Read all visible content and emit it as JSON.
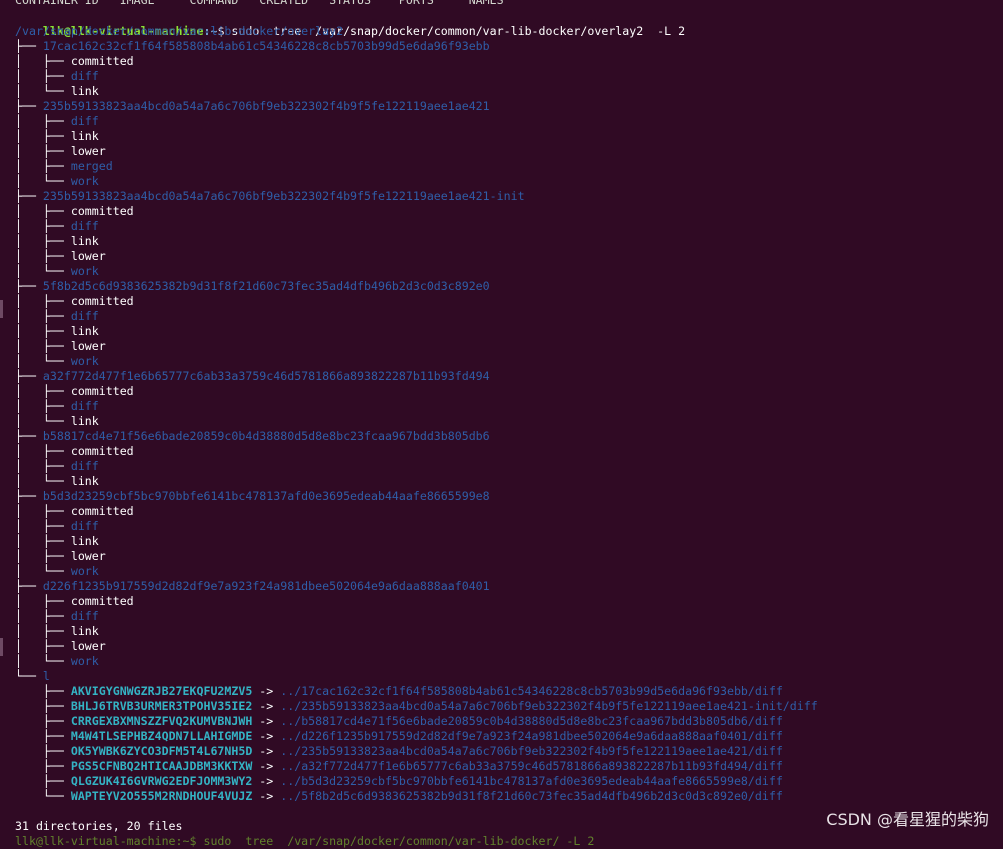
{
  "terminal": {
    "top_cut_line": "CONTAINER ID   IMAGE     COMMAND   CREATED   STATUS    PORTS     NAMES",
    "prompt": {
      "user_host": "llk@llk-virtual-machine",
      "path": ":~",
      "symbol": "$",
      "command": " sudo  tree  /var/snap/docker/common/var-lib-docker/overlay2  -L 2"
    },
    "root_dir": "/var/snap/docker/common/var-lib-docker/overlay2",
    "entries": [
      {
        "prefix": "├── ",
        "name": "17cac162c32cf1f64f585808b4ab61c54346228c8cb5703b99d5e6da96f93ebb",
        "type": "dir",
        "children": [
          {
            "prefix": "│   ├── ",
            "name": "committed",
            "type": "file"
          },
          {
            "prefix": "│   ├── ",
            "name": "diff",
            "type": "dir"
          },
          {
            "prefix": "│   └── ",
            "name": "link",
            "type": "file"
          }
        ]
      },
      {
        "prefix": "├── ",
        "name": "235b59133823aa4bcd0a54a7a6c706bf9eb322302f4b9f5fe122119aee1ae421",
        "type": "dir",
        "children": [
          {
            "prefix": "│   ├── ",
            "name": "diff",
            "type": "dir"
          },
          {
            "prefix": "│   ├── ",
            "name": "link",
            "type": "file"
          },
          {
            "prefix": "│   ├── ",
            "name": "lower",
            "type": "file"
          },
          {
            "prefix": "│   ├── ",
            "name": "merged",
            "type": "dir"
          },
          {
            "prefix": "│   └── ",
            "name": "work",
            "type": "dir"
          }
        ]
      },
      {
        "prefix": "├── ",
        "name": "235b59133823aa4bcd0a54a7a6c706bf9eb322302f4b9f5fe122119aee1ae421-init",
        "type": "dir",
        "children": [
          {
            "prefix": "│   ├── ",
            "name": "committed",
            "type": "file"
          },
          {
            "prefix": "│   ├── ",
            "name": "diff",
            "type": "dir"
          },
          {
            "prefix": "│   ├── ",
            "name": "link",
            "type": "file"
          },
          {
            "prefix": "│   ├── ",
            "name": "lower",
            "type": "file"
          },
          {
            "prefix": "│   └── ",
            "name": "work",
            "type": "dir"
          }
        ]
      },
      {
        "prefix": "├── ",
        "name": "5f8b2d5c6d9383625382b9d31f8f21d60c73fec35ad4dfb496b2d3c0d3c892e0",
        "type": "dir",
        "children": [
          {
            "prefix": "│   ├── ",
            "name": "committed",
            "type": "file"
          },
          {
            "prefix": "│   ├── ",
            "name": "diff",
            "type": "dir"
          },
          {
            "prefix": "│   ├── ",
            "name": "link",
            "type": "file"
          },
          {
            "prefix": "│   ├── ",
            "name": "lower",
            "type": "file"
          },
          {
            "prefix": "│   └── ",
            "name": "work",
            "type": "dir"
          }
        ]
      },
      {
        "prefix": "├── ",
        "name": "a32f772d477f1e6b65777c6ab33a3759c46d5781866a893822287b11b93fd494",
        "type": "dir",
        "children": [
          {
            "prefix": "│   ├── ",
            "name": "committed",
            "type": "file"
          },
          {
            "prefix": "│   ├── ",
            "name": "diff",
            "type": "dir"
          },
          {
            "prefix": "│   └── ",
            "name": "link",
            "type": "file"
          }
        ]
      },
      {
        "prefix": "├── ",
        "name": "b58817cd4e71f56e6bade20859c0b4d38880d5d8e8bc23fcaa967bdd3b805db6",
        "type": "dir",
        "children": [
          {
            "prefix": "│   ├── ",
            "name": "committed",
            "type": "file"
          },
          {
            "prefix": "│   ├── ",
            "name": "diff",
            "type": "dir"
          },
          {
            "prefix": "│   └── ",
            "name": "link",
            "type": "file"
          }
        ]
      },
      {
        "prefix": "├── ",
        "name": "b5d3d23259cbf5bc970bbfe6141bc478137afd0e3695edeab44aafe8665599e8",
        "type": "dir",
        "children": [
          {
            "prefix": "│   ├── ",
            "name": "committed",
            "type": "file"
          },
          {
            "prefix": "│   ├── ",
            "name": "diff",
            "type": "dir"
          },
          {
            "prefix": "│   ├── ",
            "name": "link",
            "type": "file"
          },
          {
            "prefix": "│   ├── ",
            "name": "lower",
            "type": "file"
          },
          {
            "prefix": "│   └── ",
            "name": "work",
            "type": "dir"
          }
        ]
      },
      {
        "prefix": "├── ",
        "name": "d226f1235b917559d2d82df9e7a923f24a981dbee502064e9a6daa888aaf0401",
        "type": "dir",
        "children": [
          {
            "prefix": "│   ├── ",
            "name": "committed",
            "type": "file"
          },
          {
            "prefix": "│   ├── ",
            "name": "diff",
            "type": "dir"
          },
          {
            "prefix": "│   ├── ",
            "name": "link",
            "type": "file"
          },
          {
            "prefix": "│   ├── ",
            "name": "lower",
            "type": "file"
          },
          {
            "prefix": "│   └── ",
            "name": "work",
            "type": "dir"
          }
        ]
      },
      {
        "prefix": "└── ",
        "name": "l",
        "type": "dir",
        "children": [
          {
            "prefix": "    ├── ",
            "name": "AKVIGYGNWGZRJB27EKQFU2MZV5",
            "type": "symlink",
            "target": "../17cac162c32cf1f64f585808b4ab61c54346228c8cb5703b99d5e6da96f93ebb/diff"
          },
          {
            "prefix": "    ├── ",
            "name": "BHLJ6TRVB3URMER3TPOHV35IE2",
            "type": "symlink",
            "target": "../235b59133823aa4bcd0a54a7a6c706bf9eb322302f4b9f5fe122119aee1ae421-init/diff"
          },
          {
            "prefix": "    ├── ",
            "name": "CRRGEXBXMNSZZFVQ2KUMVBNJWH",
            "type": "symlink",
            "target": "../b58817cd4e71f56e6bade20859c0b4d38880d5d8e8bc23fcaa967bdd3b805db6/diff"
          },
          {
            "prefix": "    ├── ",
            "name": "M4W4TLSEPHBZ4QDN7LLAHIGMDE",
            "type": "symlink",
            "target": "../d226f1235b917559d2d82df9e7a923f24a981dbee502064e9a6daa888aaf0401/diff"
          },
          {
            "prefix": "    ├── ",
            "name": "OK5YWBK6ZYCO3DFM5T4L67NH5D",
            "type": "symlink",
            "target": "../235b59133823aa4bcd0a54a7a6c706bf9eb322302f4b9f5fe122119aee1ae421/diff"
          },
          {
            "prefix": "    ├── ",
            "name": "PGS5CFNBQ2HTICAAJDBM3KKTXW",
            "type": "symlink",
            "target": "../a32f772d477f1e6b65777c6ab33a3759c46d5781866a893822287b11b93fd494/diff"
          },
          {
            "prefix": "    ├── ",
            "name": "QLGZUK4I6GVRWG2EDFJOMM3WY2",
            "type": "symlink",
            "target": "../b5d3d23259cbf5bc970bbfe6141bc478137afd0e3695edeab44aafe8665599e8/diff"
          },
          {
            "prefix": "    └── ",
            "name": "WAPTEYV2O555M2RNDHOUF4VUJZ",
            "type": "symlink",
            "target": "../5f8b2d5c6d9383625382b9d31f8f21d60c73fec35ad4dfb496b2d3c0d3c892e0/diff"
          }
        ]
      }
    ],
    "arrow": " -> ",
    "summary": "31 directories, 20 files",
    "next_prompt_cut": "llk@llk-virtual-machine:~$ sudo  tree  /var/snap/docker/common/var-lib-docker/ -L 2"
  },
  "watermark": "CSDN @看星猩的柴狗",
  "colors": {
    "background": "#300a24",
    "directory": "#2f5ea8",
    "symlink": "#34b3c4",
    "prompt_user": "#8ae234",
    "prompt_path": "#729fcf"
  }
}
